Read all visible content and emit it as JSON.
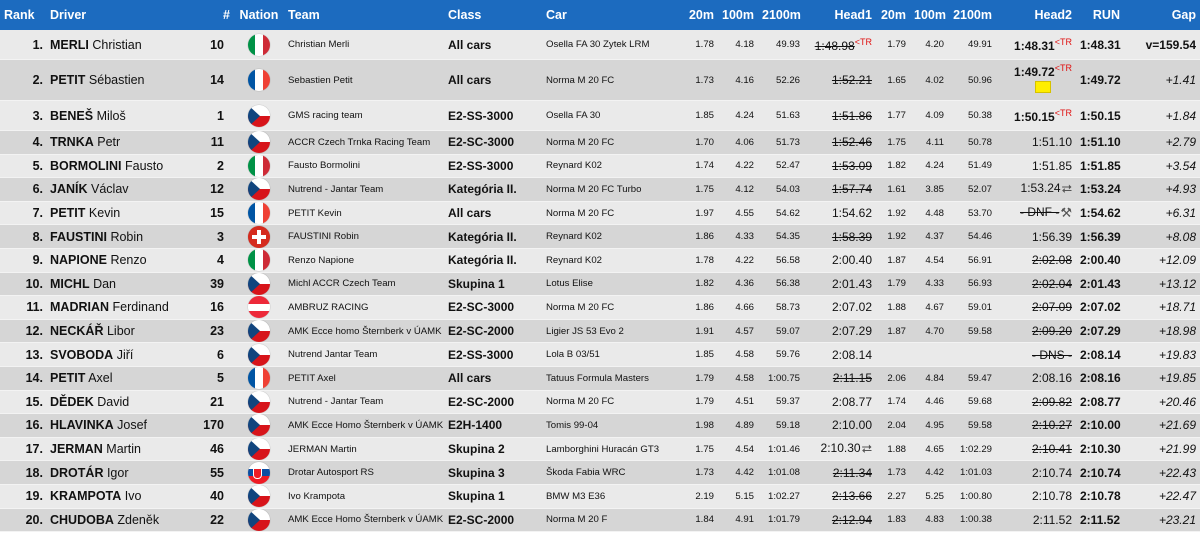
{
  "header": {
    "rank": "Rank",
    "driver": "Driver",
    "num": "#",
    "nation": "Nation",
    "team": "Team",
    "class": "Class",
    "car": "Car",
    "s20m_1": "20m",
    "s100m_1": "100m",
    "s2100m_1": "2100m",
    "head1": "Head1",
    "s20m_2": "20m",
    "s100m_2": "100m",
    "s2100m_2": "2100m",
    "head2": "Head2",
    "run": "RUN",
    "gap": "Gap"
  },
  "flags": {
    "IT": "IT",
    "FR": "FR",
    "CZ": "CZ",
    "CH": "CH",
    "AT": "AT",
    "SK": "SK"
  },
  "rows": [
    {
      "rank": "1.",
      "last": "MERLI",
      "first": "Christian",
      "num": "10",
      "nation": "IT",
      "team": "Christian Merli",
      "class": "All cars",
      "car": "Osella FA 30 Zytek LRM",
      "a20": "1.78",
      "a100": "4.18",
      "a2100": "49.93",
      "head1": "1:48.98",
      "h1style": "strike",
      "h1tr": "<TR",
      "b20": "1.79",
      "b100": "4.20",
      "b2100": "49.91",
      "head2": "1:48.31",
      "h2style": "bold",
      "h2tr": "<TR",
      "run": "1:48.31",
      "gap": "v=159.54"
    },
    {
      "rank": "2.",
      "last": "PETIT",
      "first": "Sébastien",
      "num": "14",
      "nation": "FR",
      "team": "Sebastien Petit",
      "class": "All cars",
      "car": "Norma M 20 FC",
      "a20": "1.73",
      "a100": "4.16",
      "a2100": "52.26",
      "head1": "1:52.21",
      "h1style": "strike",
      "b20": "1.65",
      "b100": "4.02",
      "b2100": "50.96",
      "head2": "1:49.72",
      "h2style": "bold",
      "h2tr": "<TR",
      "h2flag": "yellow",
      "run": "1:49.72",
      "gap": "+1.41"
    },
    {
      "rank": "3.",
      "last": "BENEŠ",
      "first": "Miloš",
      "num": "1",
      "nation": "CZ",
      "team": "GMS racing team",
      "class": "E2-SS-3000",
      "car": "Osella FA 30",
      "a20": "1.85",
      "a100": "4.24",
      "a2100": "51.63",
      "head1": "1:51.86",
      "h1style": "strike",
      "b20": "1.77",
      "b100": "4.09",
      "b2100": "50.38",
      "head2": "1:50.15",
      "h2style": "bold",
      "h2tr": "<TR",
      "run": "1:50.15",
      "gap": "+1.84"
    },
    {
      "rank": "4.",
      "last": "TRNKA",
      "first": "Petr",
      "num": "11",
      "nation": "CZ",
      "team": "ACCR Czech Trnka Racing Team",
      "class": "E2-SC-3000",
      "car": "Norma M 20 FC",
      "a20": "1.70",
      "a100": "4.06",
      "a2100": "51.73",
      "head1": "1:52.46",
      "h1style": "strike",
      "b20": "1.75",
      "b100": "4.11",
      "b2100": "50.78",
      "head2": "1:51.10",
      "h2style": "",
      "run": "1:51.10",
      "gap": "+2.79"
    },
    {
      "rank": "5.",
      "last": "BORMOLINI",
      "first": "Fausto",
      "num": "2",
      "nation": "IT",
      "team": "Fausto Bormolini",
      "class": "E2-SS-3000",
      "car": "Reynard K02",
      "a20": "1.74",
      "a100": "4.22",
      "a2100": "52.47",
      "head1": "1:53.09",
      "h1style": "strike",
      "b20": "1.82",
      "b100": "4.24",
      "b2100": "51.49",
      "head2": "1:51.85",
      "h2style": "",
      "run": "1:51.85",
      "gap": "+3.54"
    },
    {
      "rank": "6.",
      "last": "JANÍK",
      "first": "Václav",
      "num": "12",
      "nation": "CZ",
      "team": "Nutrend - Jantar Team",
      "class": "Kategória II.",
      "car": "Norma M 20 FC Turbo",
      "a20": "1.75",
      "a100": "4.12",
      "a2100": "54.03",
      "head1": "1:57.74",
      "h1style": "strike",
      "b20": "1.61",
      "b100": "3.85",
      "b2100": "52.07",
      "head2": "1:53.24",
      "h2style": "",
      "h2icon": "⮂",
      "run": "1:53.24",
      "gap": "+4.93"
    },
    {
      "rank": "7.",
      "last": "PETIT",
      "first": "Kevin",
      "num": "15",
      "nation": "FR",
      "team": "PETIT Kevin",
      "class": "All cars",
      "car": "Norma M 20 FC",
      "a20": "1.97",
      "a100": "4.55",
      "a2100": "54.62",
      "head1": "1:54.62",
      "h1style": "",
      "b20": "1.92",
      "b100": "4.48",
      "b2100": "53.70",
      "head2": "- DNF -",
      "h2style": "strike",
      "h2icon": "⚒",
      "run": "1:54.62",
      "gap": "+6.31"
    },
    {
      "rank": "8.",
      "last": "FAUSTINI",
      "first": "Robin",
      "num": "3",
      "nation": "CH",
      "team": "FAUSTINI Robin",
      "class": "Kategória II.",
      "car": "Reynard K02",
      "a20": "1.86",
      "a100": "4.33",
      "a2100": "54.35",
      "head1": "1:58.39",
      "h1style": "strike",
      "b20": "1.92",
      "b100": "4.37",
      "b2100": "54.46",
      "head2": "1:56.39",
      "h2style": "",
      "run": "1:56.39",
      "gap": "+8.08"
    },
    {
      "rank": "9.",
      "last": "NAPIONE",
      "first": "Renzo",
      "num": "4",
      "nation": "IT",
      "team": "Renzo Napione",
      "class": "Kategória II.",
      "car": "Reynard K02",
      "a20": "1.78",
      "a100": "4.22",
      "a2100": "56.58",
      "head1": "2:00.40",
      "h1style": "",
      "b20": "1.87",
      "b100": "4.54",
      "b2100": "56.91",
      "head2": "2:02.08",
      "h2style": "strike",
      "run": "2:00.40",
      "gap": "+12.09"
    },
    {
      "rank": "10.",
      "last": "MICHL",
      "first": "Dan",
      "num": "39",
      "nation": "CZ",
      "team": "Michl ACCR Czech Team",
      "class": "Skupina 1",
      "car": "Lotus Elise",
      "a20": "1.82",
      "a100": "4.36",
      "a2100": "56.38",
      "head1": "2:01.43",
      "h1style": "",
      "b20": "1.79",
      "b100": "4.33",
      "b2100": "56.93",
      "head2": "2:02.04",
      "h2style": "strike",
      "run": "2:01.43",
      "gap": "+13.12"
    },
    {
      "rank": "11.",
      "last": "MADRIAN",
      "first": "Ferdinand",
      "num": "16",
      "nation": "AT",
      "team": "AMBRUZ RACING",
      "class": "E2-SC-3000",
      "car": "Norma M 20 FC",
      "a20": "1.86",
      "a100": "4.66",
      "a2100": "58.73",
      "head1": "2:07.02",
      "h1style": "",
      "b20": "1.88",
      "b100": "4.67",
      "b2100": "59.01",
      "head2": "2:07.09",
      "h2style": "strike",
      "run": "2:07.02",
      "gap": "+18.71"
    },
    {
      "rank": "12.",
      "last": "NECKÁŘ",
      "first": "Libor",
      "num": "23",
      "nation": "CZ",
      "team": "AMK Ecce homo Šternberk v ÚAMK",
      "class": "E2-SC-2000",
      "car": "Ligier JS 53 Evo 2",
      "a20": "1.91",
      "a100": "4.57",
      "a2100": "59.07",
      "head1": "2:07.29",
      "h1style": "",
      "b20": "1.87",
      "b100": "4.70",
      "b2100": "59.58",
      "head2": "2:09.20",
      "h2style": "strike",
      "run": "2:07.29",
      "gap": "+18.98"
    },
    {
      "rank": "13.",
      "last": "SVOBODA",
      "first": "Jiří",
      "num": "6",
      "nation": "CZ",
      "team": "Nutrend Jantar Team",
      "class": "E2-SS-3000",
      "car": "Lola B 03/51",
      "a20": "1.85",
      "a100": "4.58",
      "a2100": "59.76",
      "head1": "2:08.14",
      "h1style": "",
      "b20": "",
      "b100": "",
      "b2100": "",
      "head2": "- DNS -",
      "h2style": "strike",
      "run": "2:08.14",
      "gap": "+19.83"
    },
    {
      "rank": "14.",
      "last": "PETIT",
      "first": "Axel",
      "num": "5",
      "nation": "FR",
      "team": "PETIT Axel",
      "class": "All cars",
      "car": "Tatuus Formula Masters",
      "a20": "1.79",
      "a100": "4.58",
      "a2100": "1:00.75",
      "head1": "2:11.15",
      "h1style": "strike",
      "b20": "2.06",
      "b100": "4.84",
      "b2100": "59.47",
      "head2": "2:08.16",
      "h2style": "",
      "run": "2:08.16",
      "gap": "+19.85"
    },
    {
      "rank": "15.",
      "last": "DĚDEK",
      "first": "David",
      "num": "21",
      "nation": "CZ",
      "team": "Nutrend - Jantar Team",
      "class": "E2-SC-2000",
      "car": "Norma M 20 FC",
      "a20": "1.79",
      "a100": "4.51",
      "a2100": "59.37",
      "head1": "2:08.77",
      "h1style": "",
      "b20": "1.74",
      "b100": "4.46",
      "b2100": "59.68",
      "head2": "2:09.82",
      "h2style": "strike",
      "run": "2:08.77",
      "gap": "+20.46"
    },
    {
      "rank": "16.",
      "last": "HLAVINKA",
      "first": "Josef",
      "num": "170",
      "nation": "CZ",
      "team": "AMK Ecce Homo Šternberk v ÚAMK",
      "class": "E2H-1400",
      "car": "Tomis 99-04",
      "a20": "1.98",
      "a100": "4.89",
      "a2100": "59.18",
      "head1": "2:10.00",
      "h1style": "",
      "b20": "2.04",
      "b100": "4.95",
      "b2100": "59.58",
      "head2": "2:10.27",
      "h2style": "strike",
      "run": "2:10.00",
      "gap": "+21.69"
    },
    {
      "rank": "17.",
      "last": "JERMAN",
      "first": "Martin",
      "num": "46",
      "nation": "CZ",
      "team": "JERMAN Martin",
      "class": "Skupina 2",
      "car": "Lamborghini Huracán GT3",
      "a20": "1.75",
      "a100": "4.54",
      "a2100": "1:01.46",
      "head1": "2:10.30",
      "h1style": "",
      "h1icon": "⮂",
      "b20": "1.88",
      "b100": "4.65",
      "b2100": "1:02.29",
      "head2": "2:10.41",
      "h2style": "strike",
      "run": "2:10.30",
      "gap": "+21.99"
    },
    {
      "rank": "18.",
      "last": "DROTÁR",
      "first": "Igor",
      "num": "55",
      "nation": "SK",
      "team": "Drotar Autosport RS",
      "class": "Skupina 3",
      "car": "Škoda Fabia WRC",
      "a20": "1.73",
      "a100": "4.42",
      "a2100": "1:01.08",
      "head1": "2:11.34",
      "h1style": "strike",
      "b20": "1.73",
      "b100": "4.42",
      "b2100": "1:01.03",
      "head2": "2:10.74",
      "h2style": "",
      "run": "2:10.74",
      "gap": "+22.43"
    },
    {
      "rank": "19.",
      "last": "KRAMPOTA",
      "first": "Ivo",
      "num": "40",
      "nation": "CZ",
      "team": "Ivo Krampota",
      "class": "Skupina 1",
      "car": "BMW M3 E36",
      "a20": "2.19",
      "a100": "5.15",
      "a2100": "1:02.27",
      "head1": "2:13.66",
      "h1style": "strike",
      "b20": "2.27",
      "b100": "5.25",
      "b2100": "1:00.80",
      "head2": "2:10.78",
      "h2style": "",
      "run": "2:10.78",
      "gap": "+22.47"
    },
    {
      "rank": "20.",
      "last": "CHUDOBA",
      "first": "Zdeněk",
      "num": "22",
      "nation": "CZ",
      "team": "AMK Ecce Homo Šternberk v ÚAMK",
      "class": "E2-SC-2000",
      "car": "Norma M 20 F",
      "a20": "1.84",
      "a100": "4.91",
      "a2100": "1:01.79",
      "head1": "2:12.94",
      "h1style": "strike",
      "b20": "1.83",
      "b100": "4.83",
      "b2100": "1:00.38",
      "head2": "2:11.52",
      "h2style": "",
      "run": "2:11.52",
      "gap": "+23.21"
    }
  ]
}
